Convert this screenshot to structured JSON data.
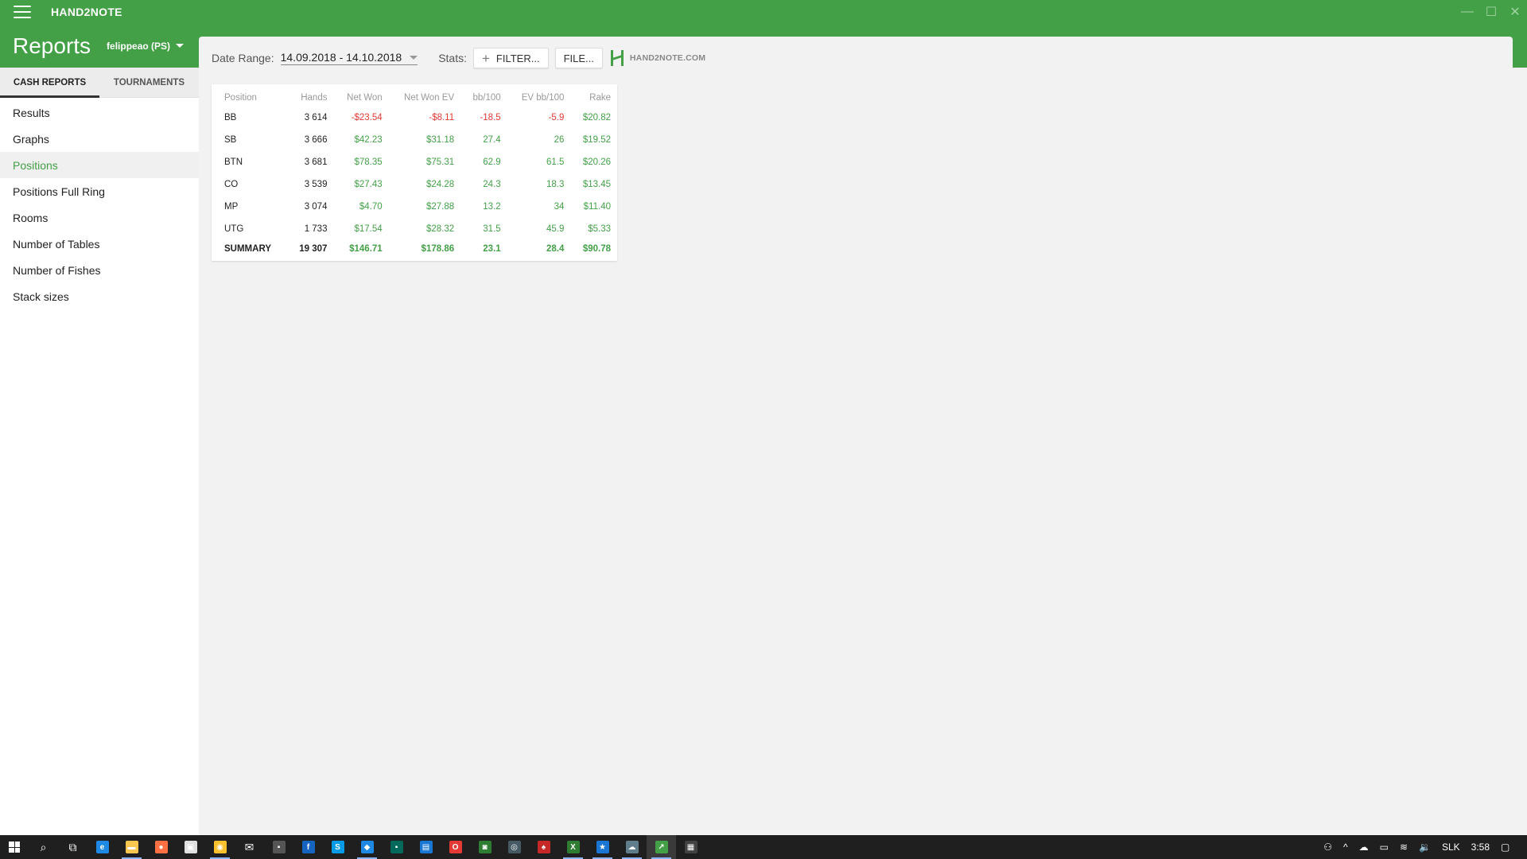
{
  "app": {
    "title": "HAND2NOTE"
  },
  "window_controls": {
    "minimize": "—",
    "maximize": "☐",
    "close": "✕"
  },
  "sidebar": {
    "title": "Reports",
    "account": "felippeao (PS)",
    "tabs": [
      {
        "label": "CASH REPORTS",
        "active": true
      },
      {
        "label": "TOURNAMENTS",
        "active": false
      }
    ],
    "items": [
      {
        "label": "Results"
      },
      {
        "label": "Graphs"
      },
      {
        "label": "Positions",
        "active": true
      },
      {
        "label": "Positions Full Ring"
      },
      {
        "label": "Rooms"
      },
      {
        "label": "Number of Tables"
      },
      {
        "label": "Number of Fishes"
      },
      {
        "label": "Stack sizes"
      }
    ]
  },
  "toolbar": {
    "date_range_label": "Date Range:",
    "date_range_value": "14.09.2018 - 14.10.2018",
    "stats_label": "Stats:",
    "filter_label": "FILTER...",
    "file_label": "FILE...",
    "logo_text": "HAND2NOTE.COM"
  },
  "table": {
    "headers": [
      "Position",
      "Hands",
      "Net Won",
      "Net Won  EV",
      "bb/100",
      "EV bb/100",
      "Rake"
    ],
    "rows": [
      [
        "BB",
        "3 614",
        "-$23.54",
        "-$8.11",
        "-18.5",
        "-5.9",
        "$20.82"
      ],
      [
        "SB",
        "3 666",
        "$42.23",
        "$31.18",
        "27.4",
        "26",
        "$19.52"
      ],
      [
        "BTN",
        "3 681",
        "$78.35",
        "$75.31",
        "62.9",
        "61.5",
        "$20.26"
      ],
      [
        "CO",
        "3 539",
        "$27.43",
        "$24.28",
        "24.3",
        "18.3",
        "$13.45"
      ],
      [
        "MP",
        "3 074",
        "$4.70",
        "$27.88",
        "13.2",
        "34",
        "$11.40"
      ],
      [
        "UTG",
        "1 733",
        "$17.54",
        "$28.32",
        "31.5",
        "45.9",
        "$5.33"
      ]
    ],
    "summary": [
      "SUMMARY",
      "19 307",
      "$146.71",
      "$178.86",
      "23.1",
      "28.4",
      "$90.78"
    ]
  },
  "colors": {
    "accent": "#43a047",
    "positive": "#43a047",
    "negative": "#e53935"
  },
  "taskbar": {
    "icons": [
      {
        "name": "search-icon",
        "glyph": "⌕",
        "color": "",
        "open": false
      },
      {
        "name": "task-view-icon",
        "glyph": "⧉",
        "color": "",
        "open": false
      },
      {
        "name": "edge-icon",
        "glyph": "e",
        "color": "#1e88e5",
        "open": false
      },
      {
        "name": "file-explorer-icon",
        "glyph": "▬",
        "color": "#f9c74f",
        "open": true
      },
      {
        "name": "firefox-icon",
        "glyph": "●",
        "color": "#ff7043",
        "open": false
      },
      {
        "name": "store-icon",
        "glyph": "▣",
        "color": "#e0e0e0",
        "open": false
      },
      {
        "name": "chrome-icon",
        "glyph": "◉",
        "color": "#fbc02d",
        "open": true
      },
      {
        "name": "mail-icon",
        "glyph": "✉",
        "color": "",
        "open": false
      },
      {
        "name": "app-icon-dark",
        "glyph": "▪",
        "color": "#555555",
        "open": false
      },
      {
        "name": "app-icon-f",
        "glyph": "f",
        "color": "#1565c0",
        "open": false
      },
      {
        "name": "skype-icon",
        "glyph": "S",
        "color": "#039be5",
        "open": false
      },
      {
        "name": "messenger-icon",
        "glyph": "◆",
        "color": "#1e88e5",
        "open": true
      },
      {
        "name": "app-icon-teal",
        "glyph": "▪",
        "color": "#00695c",
        "open": false
      },
      {
        "name": "app-icon-blue",
        "glyph": "▤",
        "color": "#1976d2",
        "open": false
      },
      {
        "name": "office-icon",
        "glyph": "O",
        "color": "#e53935",
        "open": false
      },
      {
        "name": "app-icon-green",
        "glyph": "◙",
        "color": "#2e7d32",
        "open": false
      },
      {
        "name": "steam-icon",
        "glyph": "◎",
        "color": "#455a64",
        "open": false
      },
      {
        "name": "pokerstars-icon",
        "glyph": "♠",
        "color": "#c62828",
        "open": false
      },
      {
        "name": "excel-icon",
        "glyph": "X",
        "color": "#2e7d32",
        "open": true
      },
      {
        "name": "app-icon-star",
        "glyph": "★",
        "color": "#1976d2",
        "open": true
      },
      {
        "name": "app-icon-cloud",
        "glyph": "☁",
        "color": "#607d8b",
        "open": true
      },
      {
        "name": "hand2note-icon",
        "glyph": "↗",
        "color": "#43a047",
        "open": true,
        "active": true
      },
      {
        "name": "calculator-icon",
        "glyph": "▦",
        "color": "#424242",
        "open": false
      }
    ],
    "tray": {
      "people": "⚇",
      "chevron": "^",
      "cloud": "☁",
      "battery": "▭",
      "wifi": "≋",
      "volume": "🔉",
      "language": "SLK",
      "time": "3:58",
      "notification": "▢"
    }
  }
}
